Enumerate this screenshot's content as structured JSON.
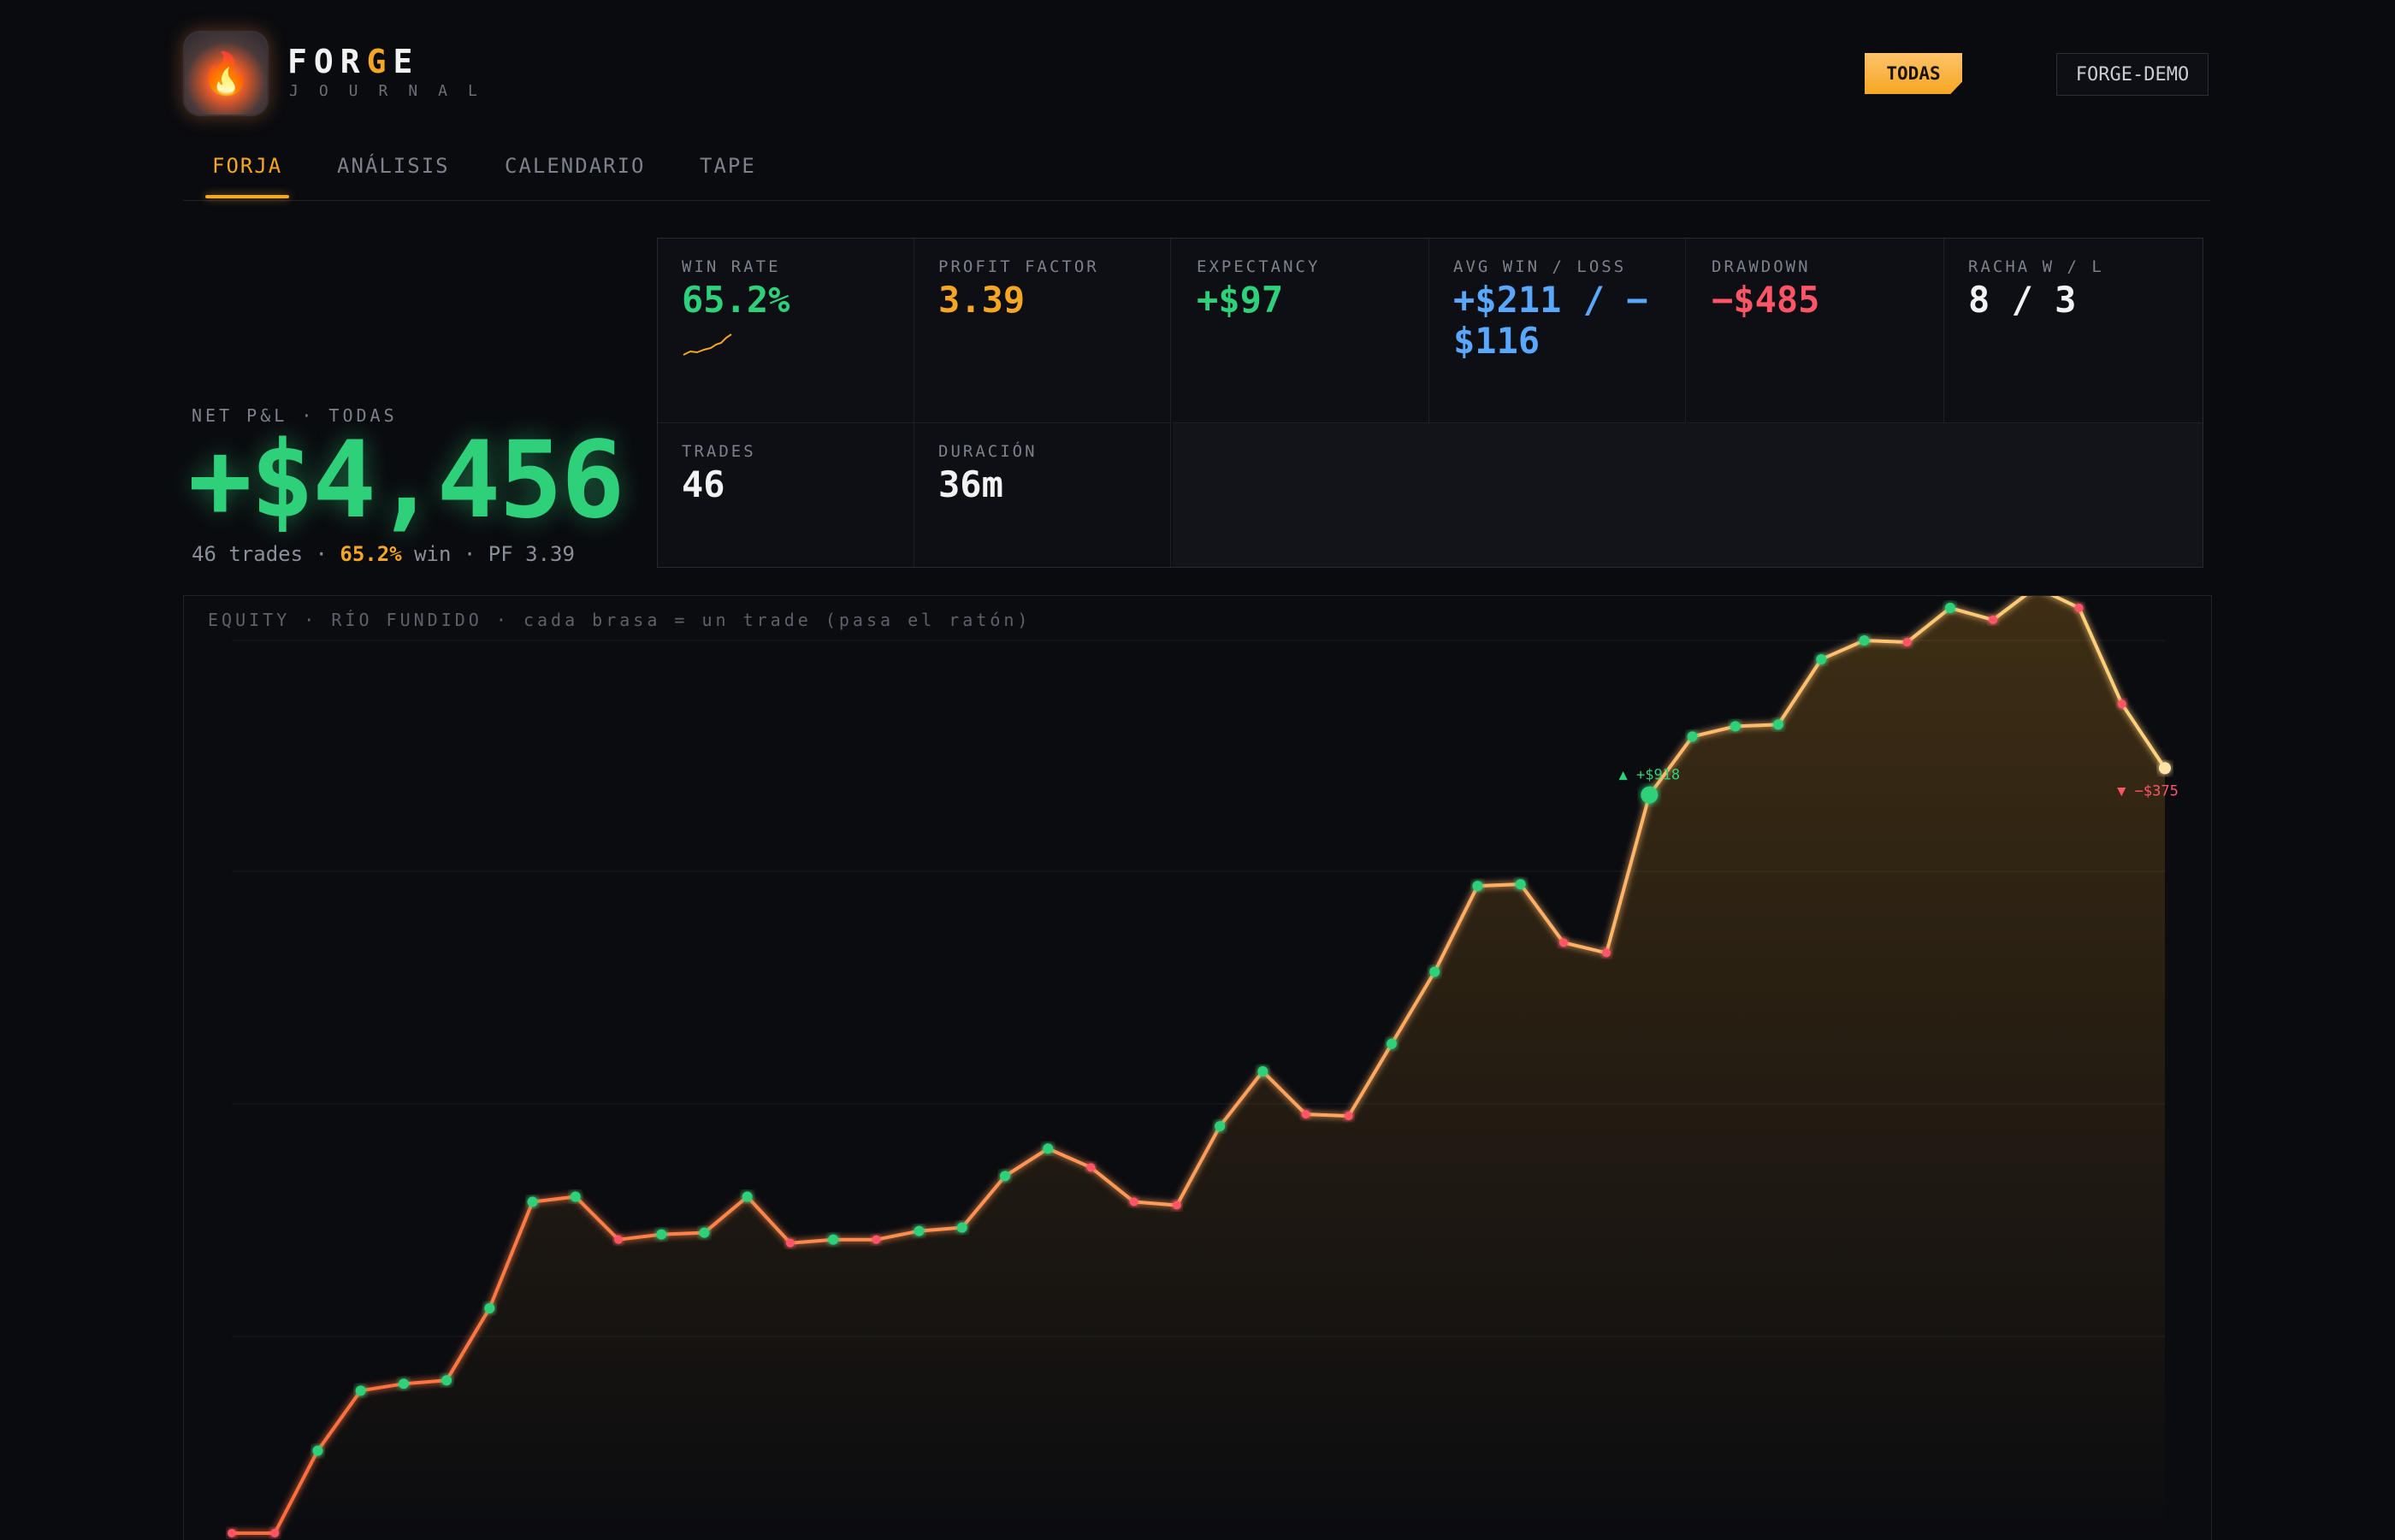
{
  "header": {
    "brand_pre": "FOR",
    "brand_hl": "G",
    "brand_post": "E",
    "brand_sub": "JOURNAL",
    "logo_icon": "flame-icon",
    "account_all_label": "TODAS",
    "account_demo_label": "FORGE-DEMO"
  },
  "tabs": [
    {
      "label": "FORJA",
      "active": true
    },
    {
      "label": "ANÁLISIS",
      "active": false
    },
    {
      "label": "CALENDARIO",
      "active": false
    },
    {
      "label": "TAPE",
      "active": false
    }
  ],
  "net": {
    "label": "NET P&L · TODAS",
    "value": "+$4,456",
    "trades_text": "46 trades · ",
    "win_pct": "65.2%",
    "win_text": " win · PF 3.39"
  },
  "stats": [
    {
      "label": "WIN RATE",
      "value": "65.2%",
      "color": "#2fd07a"
    },
    {
      "label": "PROFIT FACTOR",
      "value": "3.39",
      "color": "#f5a623"
    },
    {
      "label": "EXPECTANCY",
      "value": "+$97",
      "color": "#2fd07a"
    },
    {
      "label": "AVG WIN / LOSS",
      "value": "+$211 / −$116",
      "color": "#5aa7ff"
    },
    {
      "label": "DRAWDOWN",
      "value": "−$485",
      "color": "#ff5566"
    },
    {
      "label": "RACHA W / L",
      "value": "8 / 3",
      "color": "#f2f2f2"
    },
    {
      "label": "TRADES",
      "value": "46",
      "color": "#f2f2f2"
    },
    {
      "label": "DURACIÓN",
      "value": "36m",
      "color": "#f2f2f2"
    }
  ],
  "chart_title": "EQUITY · RÍO FUNDIDO · cada brasa = un trade (pasa el ratón)",
  "colors": {
    "accent": "#f5a623",
    "win": "#2fd07a",
    "loss": "#ff5566",
    "line": "#ffb066"
  },
  "chart_data": {
    "type": "line",
    "title": "EQUITY · RÍO FUNDIDO · cada brasa = un trade (pasa el ratón)",
    "xlabel": "",
    "ylabel": "",
    "ylim": [
      -40,
      5200
    ],
    "x": [
      1,
      2,
      3,
      4,
      5,
      6,
      7,
      8,
      9,
      10,
      11,
      12,
      13,
      14,
      15,
      16,
      17,
      18,
      19,
      20,
      21,
      22,
      23,
      24,
      25,
      26,
      27,
      28,
      29,
      30,
      31,
      32,
      33,
      34,
      35,
      36,
      37,
      38,
      39,
      40,
      41,
      42,
      43,
      44,
      45,
      46
    ],
    "series": [
      {
        "name": "",
        "values": [
          0,
          0,
          480,
          830,
          870,
          890,
          1310,
          1930,
          1960,
          1710,
          1740,
          1750,
          1960,
          1690,
          1710,
          1710,
          1760,
          1780,
          2080,
          2240,
          2130,
          1930,
          1910,
          2370,
          2690,
          2440,
          2430,
          2850,
          3270,
          3770,
          3780,
          3440,
          3380,
          4300,
          4640,
          4700,
          4710,
          5090,
          5200,
          5190,
          5390,
          5320,
          5510,
          5390,
          4830,
          4456
        ]
      },
      {
        "name": "win",
        "values": [
          0,
          0,
          1,
          1,
          1,
          1,
          1,
          1,
          1,
          0,
          1,
          1,
          1,
          0,
          1,
          0,
          1,
          1,
          1,
          1,
          0,
          0,
          0,
          1,
          1,
          0,
          0,
          1,
          1,
          1,
          1,
          0,
          0,
          1,
          1,
          1,
          1,
          1,
          1,
          0,
          1,
          0,
          1,
          0,
          0,
          0
        ]
      }
    ],
    "annotations": [
      {
        "trade": 34,
        "text": "▲ +$918"
      },
      {
        "trade": 46,
        "text": "▼ −$375"
      }
    ],
    "grid": true
  }
}
